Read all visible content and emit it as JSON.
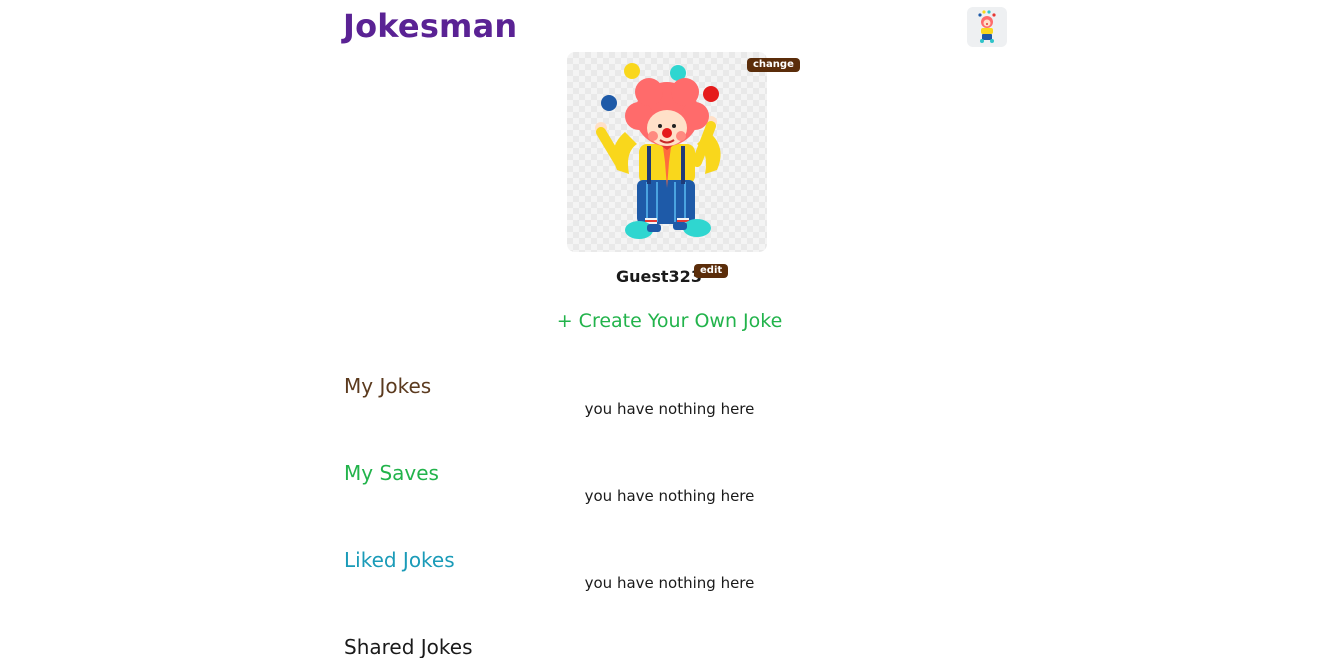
{
  "header": {
    "brand": "Jokesman",
    "avatar_icon": "clown-avatar-icon"
  },
  "profile": {
    "change_label": "change",
    "username": "Guest323",
    "edit_label": "edit"
  },
  "create_link": "+ Create Your Own Joke",
  "sections": [
    {
      "title": "My Jokes",
      "empty": "you have nothing here",
      "color": "#5b3a1e"
    },
    {
      "title": "My Saves",
      "empty": "you have nothing here",
      "color": "#22b34b"
    },
    {
      "title": "Liked Jokes",
      "empty": "you have nothing here",
      "color": "#1a9bb8"
    },
    {
      "title": "Shared Jokes",
      "color": "#1a1a1a"
    }
  ]
}
